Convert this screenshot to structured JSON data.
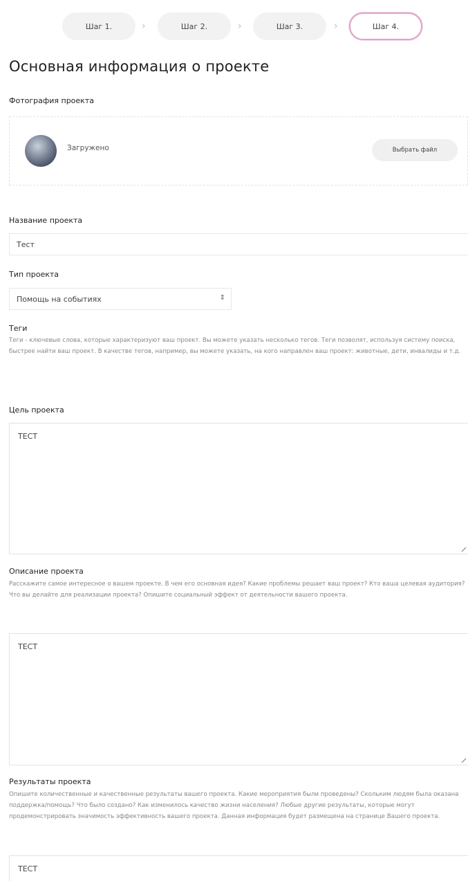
{
  "steps": [
    {
      "label": "Шаг 1."
    },
    {
      "label": "Шаг 2."
    },
    {
      "label": "Шаг 3."
    },
    {
      "label": "Шаг 4."
    }
  ],
  "step_separator": "›",
  "active_step_color": "#e0a3c8",
  "page_title": "Основная информация о проекте",
  "photo": {
    "label": "Фотография проекта",
    "status": "Загружено",
    "button_label": "Выбрать файл"
  },
  "name": {
    "label": "Название проекта",
    "value": "Тест"
  },
  "type": {
    "label": "Тип проекта",
    "value": "Помощь на событиях",
    "arrow_icon": "up-down-arrow-icon"
  },
  "tags": {
    "label": "Теги",
    "help": "Теги - ключевые слова, которые характеризуют ваш проект. Вы можете указать несколько тегов. Теги позволят, используя систему поиска, быстрее найти ваш проект. В качестве тегов, например, вы можете указать, на кого направлен ваш проект: животные, дети, инвалиды и т.д."
  },
  "goal": {
    "label": "Цель проекта",
    "value": "ТЕСТ"
  },
  "description": {
    "label": "Описание проекта",
    "help": "Расскажите самое интересное о вашем проекте. В чем его основная идея? Какие проблемы решает ваш проект? Кто ваша целевая аудитория? Что вы делайте для реализации проекта? Опишите социальный эффект от деятельности вашего проекта.",
    "value": "ТЕСТ"
  },
  "results": {
    "label": "Результаты проекта",
    "help": "Опишите количественные и качественные результаты вашего проекта. Какие мероприятия были проведены? Скольким людям была оказана поддержка/помощь? Что было создано? Как изменилось качество жизни населения? Любые другие результаты, которые могут продемонстрировать значимость эффективность вашего проекта. Данная информация будет размещена на странице Вашего проекта.",
    "value": "ТЕСТ"
  }
}
